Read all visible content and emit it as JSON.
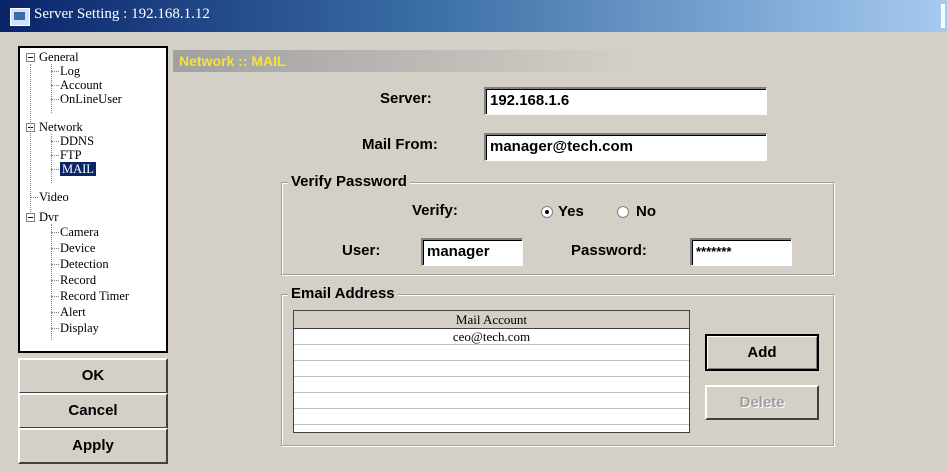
{
  "window": {
    "title": "Server Setting : 192.168.1.12"
  },
  "tree": {
    "general": "General",
    "log": "Log",
    "account": "Account",
    "online_user": "OnLineUser",
    "network": "Network",
    "ddns": "DDNS",
    "ftp": "FTP",
    "mail": "MAIL",
    "video": "Video",
    "dvr": "Dvr",
    "camera": "Camera",
    "device": "Device",
    "detection": "Detection",
    "record": "Record",
    "record_timer": "Record Timer",
    "alert": "Alert",
    "display": "Display",
    "selected": "MAIL"
  },
  "buttons": {
    "ok": "OK",
    "cancel": "Cancel",
    "apply": "Apply",
    "add": "Add",
    "delete": "Delete"
  },
  "section": {
    "title": "Network :: MAIL"
  },
  "form": {
    "server_label": "Server:",
    "server_value": "192.168.1.6",
    "mail_from_label": "Mail From:",
    "mail_from_value": "manager@tech.com"
  },
  "verify": {
    "group_title": "Verify Password",
    "verify_label": "Verify:",
    "yes_label": "Yes",
    "no_label": "No",
    "selected": "Yes",
    "user_label": "User:",
    "user_value": "manager",
    "password_label": "Password:",
    "password_value": "*******"
  },
  "email": {
    "group_title": "Email Address",
    "column_header": "Mail Account",
    "accounts": [
      "ceo@tech.com",
      "",
      "",
      "",
      "",
      "",
      ""
    ]
  },
  "colors": {
    "title_bar": "#0a246a",
    "section_text": "#f6e23d",
    "selection": "#0a246a"
  },
  "icons": {
    "app": "server-setting-icon"
  }
}
